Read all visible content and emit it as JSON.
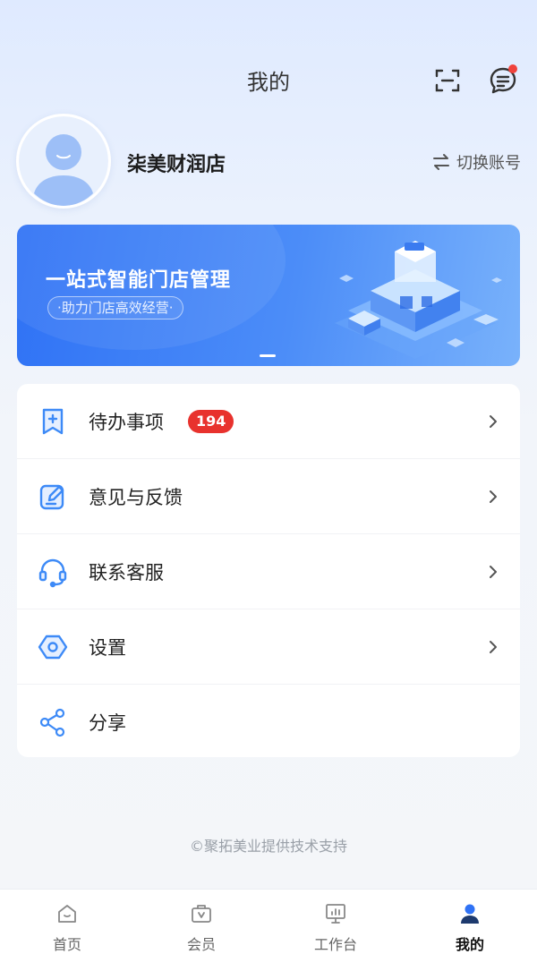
{
  "header": {
    "title": "我的"
  },
  "profile": {
    "store_name": "柒美财润店",
    "switch_label": "切换账号"
  },
  "banner": {
    "title": "一站式智能门店管理",
    "subtitle": "·助力门店高效经营·"
  },
  "menu": [
    {
      "label": "待办事项",
      "badge": "194",
      "icon": "todo-bookmark-icon"
    },
    {
      "label": "意见与反馈",
      "icon": "feedback-edit-icon"
    },
    {
      "label": "联系客服",
      "icon": "headset-icon"
    },
    {
      "label": "设置",
      "icon": "settings-hexagon-icon"
    },
    {
      "label": "分享",
      "icon": "share-icon"
    }
  ],
  "footer": {
    "text": "©聚拓美业提供技术支持"
  },
  "tabbar": [
    {
      "label": "首页",
      "icon": "home-icon"
    },
    {
      "label": "会员",
      "icon": "member-icon"
    },
    {
      "label": "工作台",
      "icon": "workbench-icon"
    },
    {
      "label": "我的",
      "icon": "profile-icon",
      "active": true
    }
  ],
  "colors": {
    "accent": "#2f72f5",
    "badge": "#e8322d",
    "icon_blue": "#3d8af7"
  }
}
